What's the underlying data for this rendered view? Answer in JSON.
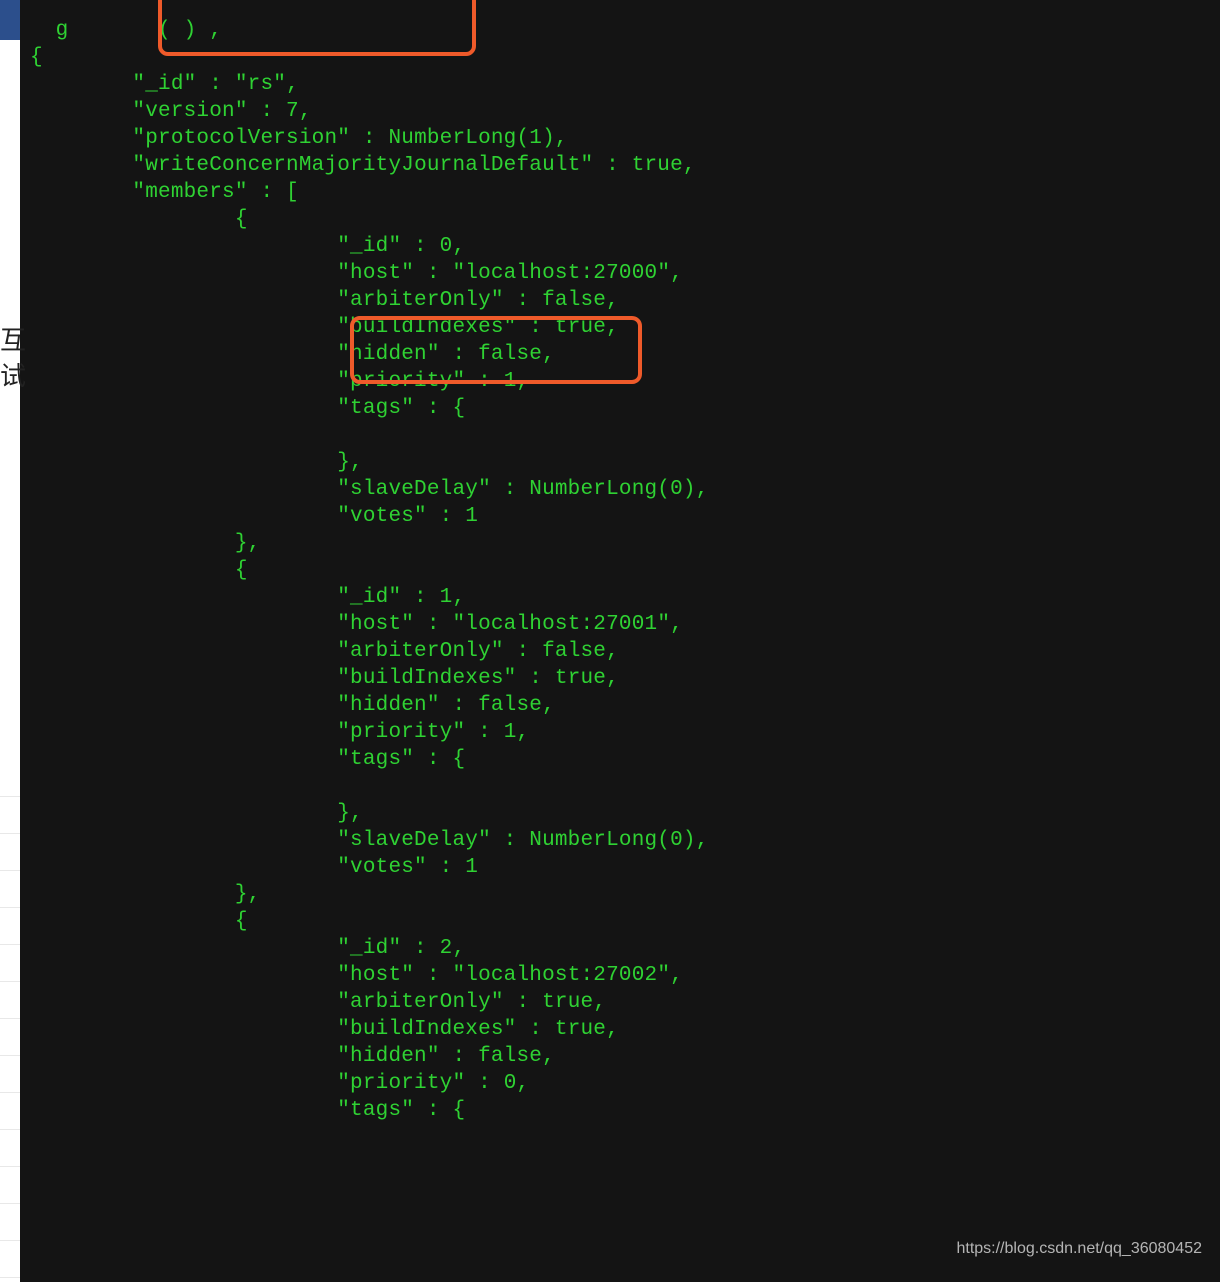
{
  "sideText": {
    "a": "互",
    "b": "试"
  },
  "watermark": "https://blog.csdn.net/qq_36080452",
  "cmdFragment": "  g       ( ) ,",
  "openBrace": "{",
  "config": {
    "_id_key": "\"_id\"",
    "_id_val": "\"rs\"",
    "version_key": "\"version\"",
    "version_val": "7",
    "protoKey": "\"protocolVersion\"",
    "protoVal": "NumberLong(1)",
    "wcmKey": "\"writeConcernMajorityJournalDefault\"",
    "wcmVal": "true",
    "membersKey": "\"members\""
  },
  "members": [
    {
      "_id": 0,
      "host": "localhost:27000",
      "arbiterOnly": "false",
      "buildIndexes": "true",
      "hidden": "false",
      "priority": 1,
      "tagsOpen": "{",
      "slaveDelay": "NumberLong(0)",
      "votes": 1
    },
    {
      "_id": 1,
      "host": "localhost:27001",
      "arbiterOnly": "false",
      "buildIndexes": "true",
      "hidden": "false",
      "priority": 1,
      "tagsOpen": "{",
      "slaveDelay": "NumberLong(0)",
      "votes": 1
    },
    {
      "_id": 2,
      "host": "localhost:27002",
      "arbiterOnly": "true",
      "buildIndexes": "true",
      "hidden": "false",
      "priority": 0,
      "tagsOpen": "{"
    }
  ]
}
